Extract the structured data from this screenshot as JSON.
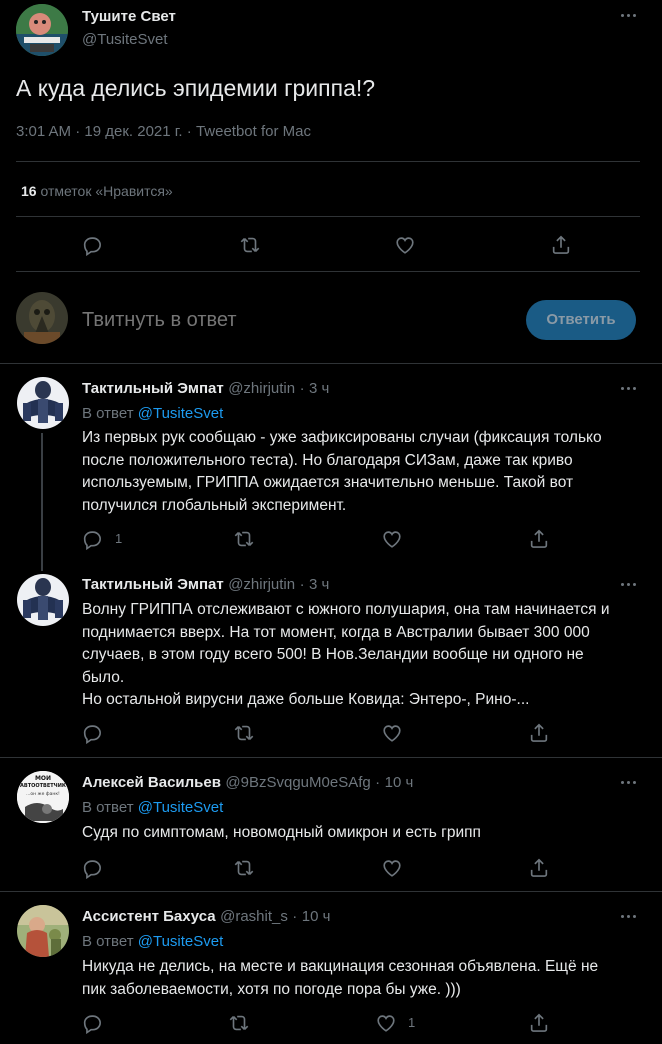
{
  "main_tweet": {
    "author_name": "Тушите Свет",
    "author_handle": "@TusiteSvet",
    "text": "А куда делись эпидемии гриппа!?",
    "time": "3:01 AM",
    "dot1": "·",
    "date": "19 дек. 2021 г.",
    "dot2": "·",
    "source": "Tweetbot for Mac",
    "likes_count": "16",
    "likes_label": "отметок «Нравится»"
  },
  "reply_box": {
    "placeholder": "Твитнуть в ответ",
    "button_label": "Ответить"
  },
  "replies": [
    {
      "name": "Тактильный Эмпат",
      "handle": "@zhirjutin",
      "dot": "·",
      "time": "3 ч",
      "reply_label": "В ответ",
      "reply_to": "@TusiteSvet",
      "lines": [
        "Из первых рук сообщаю - уже зафиксированы случаи (фиксация только",
        "после положительного теста). Но благодаря СИЗам, даже так криво",
        "используемым, ГРИППА ожидается значительно меньше. Такой вот",
        "получился глобальный эксперимент."
      ],
      "reply_count": "1",
      "like_count": ""
    },
    {
      "name": "Тактильный Эмпат",
      "handle": "@zhirjutin",
      "dot": "·",
      "time": "3 ч",
      "lines": [
        "Волну ГРИППА отслеживают с южного полушария, она там начинается и",
        "поднимается вверх. На тот момент, когда в Австралии бывает 300 000",
        "случаев, в этом году всего 500! В Нов.Зеландии вообще ни одного не",
        "было.",
        "Но остальной вирусни даже больше Ковида: Энтеро-, Рино-..."
      ],
      "reply_count": "",
      "like_count": ""
    },
    {
      "name": "Алексей Васильев",
      "handle": "@9BzSvqguM0eSAfg",
      "dot": "·",
      "time": "10 ч",
      "reply_label": "В ответ",
      "reply_to": "@TusiteSvet",
      "avatar_text_1": "МОИ",
      "avatar_text_2": "АВТООТВЕТЧИК",
      "avatar_text_3": "...он же фанк!",
      "lines": [
        "Судя по симптомам, новомодный омикрон и есть грипп"
      ],
      "reply_count": "",
      "like_count": ""
    },
    {
      "name": "Ассистент Бахуса",
      "handle": "@rashit_s",
      "dot": "·",
      "time": "10 ч",
      "reply_label": "В ответ",
      "reply_to": "@TusiteSvet",
      "lines": [
        "Никуда не делись, на месте и вакцинация сезонная объявлена. Ещё не",
        "пик заболеваемости, хотя по погоде пора бы уже. )))"
      ],
      "reply_count": "",
      "like_count": "1"
    }
  ],
  "colors": {
    "background": "#000000",
    "accent": "#1d9bf0",
    "button_bg": "#1a5b85",
    "divider": "#2f3336",
    "secondary_text": "#6e767d"
  },
  "icons": [
    "more-icon",
    "reply-icon",
    "retweet-icon",
    "like-icon",
    "share-icon"
  ]
}
